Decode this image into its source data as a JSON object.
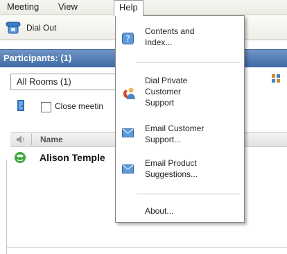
{
  "menubar": {
    "items": [
      {
        "label": "Meeting"
      },
      {
        "label": "View"
      },
      {
        "label": "Help"
      }
    ]
  },
  "toolbar": {
    "dial_out_label": "Dial Out"
  },
  "panel": {
    "title": "Participants: (1)"
  },
  "rooms": {
    "selected": "All Rooms  (1)"
  },
  "close_meetings": {
    "label": "Close meetin"
  },
  "grid": {
    "columns": {
      "name": "Name"
    },
    "rows": [
      {
        "name": "Alison Temple"
      }
    ]
  },
  "help_menu": {
    "items": [
      {
        "line1": "Contents and",
        "line2": "Index...",
        "icon": "help-book-icon"
      },
      {
        "line1": "Dial Private",
        "line2": "Customer",
        "line3": "Support",
        "icon": "dial-support-icon"
      },
      {
        "line1": "Email Customer",
        "line2": "Support...",
        "icon": "envelope-icon"
      },
      {
        "line1": "Email Product",
        "line2": "Suggestions...",
        "icon": "envelope-icon"
      },
      {
        "line1": "About...",
        "icon": "none"
      }
    ]
  },
  "colors": {
    "header_blue": "#4f78b0",
    "menu_bg": "#f2f1ec",
    "icon_blue": "#4a86c5",
    "icon_green": "#3aa83a"
  }
}
